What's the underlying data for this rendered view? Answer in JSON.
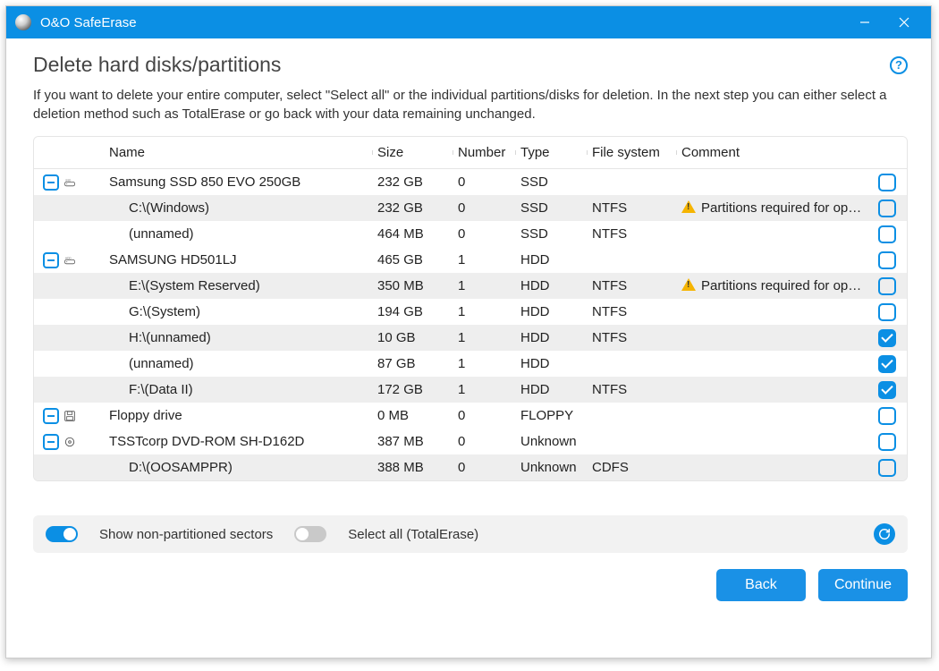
{
  "titlebar": {
    "app_title": "O&O SafeErase"
  },
  "page": {
    "title": "Delete hard disks/partitions",
    "description": "If you want to delete your entire computer, select \"Select all\" or the individual partitions/disks for deletion. In the next step you can either select a deletion method such as TotalErase or go back with your data remaining unchanged."
  },
  "columns": {
    "name": "Name",
    "size": "Size",
    "number": "Number",
    "type": "Type",
    "fs": "File system",
    "comment": "Comment"
  },
  "warn_text": "Partitions required for operation.",
  "drives": [
    {
      "icon": "ssd",
      "name": "Samsung SSD 850 EVO 250GB",
      "size": "232 GB",
      "number": "0",
      "type": "SSD",
      "fs": "",
      "comment": "",
      "checked": false,
      "children": [
        {
          "icon": "ssd-part",
          "name": "C:\\(Windows)",
          "size": "232 GB",
          "number": "0",
          "type": "SSD",
          "fs": "NTFS",
          "warn": true,
          "checked": false,
          "alt": true
        },
        {
          "icon": "ssd-part",
          "name": "(unnamed)",
          "size": "464 MB",
          "number": "0",
          "type": "SSD",
          "fs": "NTFS",
          "warn": false,
          "checked": false,
          "alt": false
        }
      ]
    },
    {
      "icon": "hdd",
      "name": "SAMSUNG HD501LJ",
      "size": "465 GB",
      "number": "1",
      "type": "HDD",
      "fs": "",
      "comment": "",
      "checked": false,
      "children": [
        {
          "icon": "hdd-part",
          "name": "E:\\(System Reserved)",
          "size": "350 MB",
          "number": "1",
          "type": "HDD",
          "fs": "NTFS",
          "warn": true,
          "checked": false,
          "alt": true
        },
        {
          "icon": "hdd-part",
          "name": "G:\\(System)",
          "size": "194 GB",
          "number": "1",
          "type": "HDD",
          "fs": "NTFS",
          "warn": false,
          "checked": false,
          "alt": false
        },
        {
          "icon": "hdd-part",
          "name": "H:\\(unnamed)",
          "size": "10 GB",
          "number": "1",
          "type": "HDD",
          "fs": "NTFS",
          "warn": false,
          "checked": true,
          "alt": true
        },
        {
          "icon": "hdd-part",
          "name": "(unnamed)",
          "size": "87 GB",
          "number": "1",
          "type": "HDD",
          "fs": "",
          "warn": false,
          "checked": true,
          "alt": false
        },
        {
          "icon": "hdd-part",
          "name": "F:\\(Data II)",
          "size": "172 GB",
          "number": "1",
          "type": "HDD",
          "fs": "NTFS",
          "warn": false,
          "checked": true,
          "alt": true
        }
      ]
    },
    {
      "icon": "floppy",
      "name": "Floppy drive",
      "size": "0 MB",
      "number": "0",
      "type": "FLOPPY",
      "fs": "",
      "comment": "",
      "checked": false,
      "children": []
    },
    {
      "icon": "optical",
      "name": "TSSTcorp DVD-ROM SH-D162D",
      "size": "387 MB",
      "number": "0",
      "type": "Unknown",
      "fs": "",
      "comment": "",
      "checked": false,
      "children": [
        {
          "icon": "optical-part",
          "name": "D:\\(OOSAMPPR)",
          "size": "388 MB",
          "number": "0",
          "type": "Unknown",
          "fs": "CDFS",
          "warn": false,
          "checked": false,
          "alt": true
        }
      ]
    }
  ],
  "bottom": {
    "show_nonpart": "Show non-partitioned sectors",
    "select_all": "Select all (TotalErase)",
    "show_on": true,
    "selectall_on": false
  },
  "footer": {
    "back": "Back",
    "continue": "Continue"
  }
}
